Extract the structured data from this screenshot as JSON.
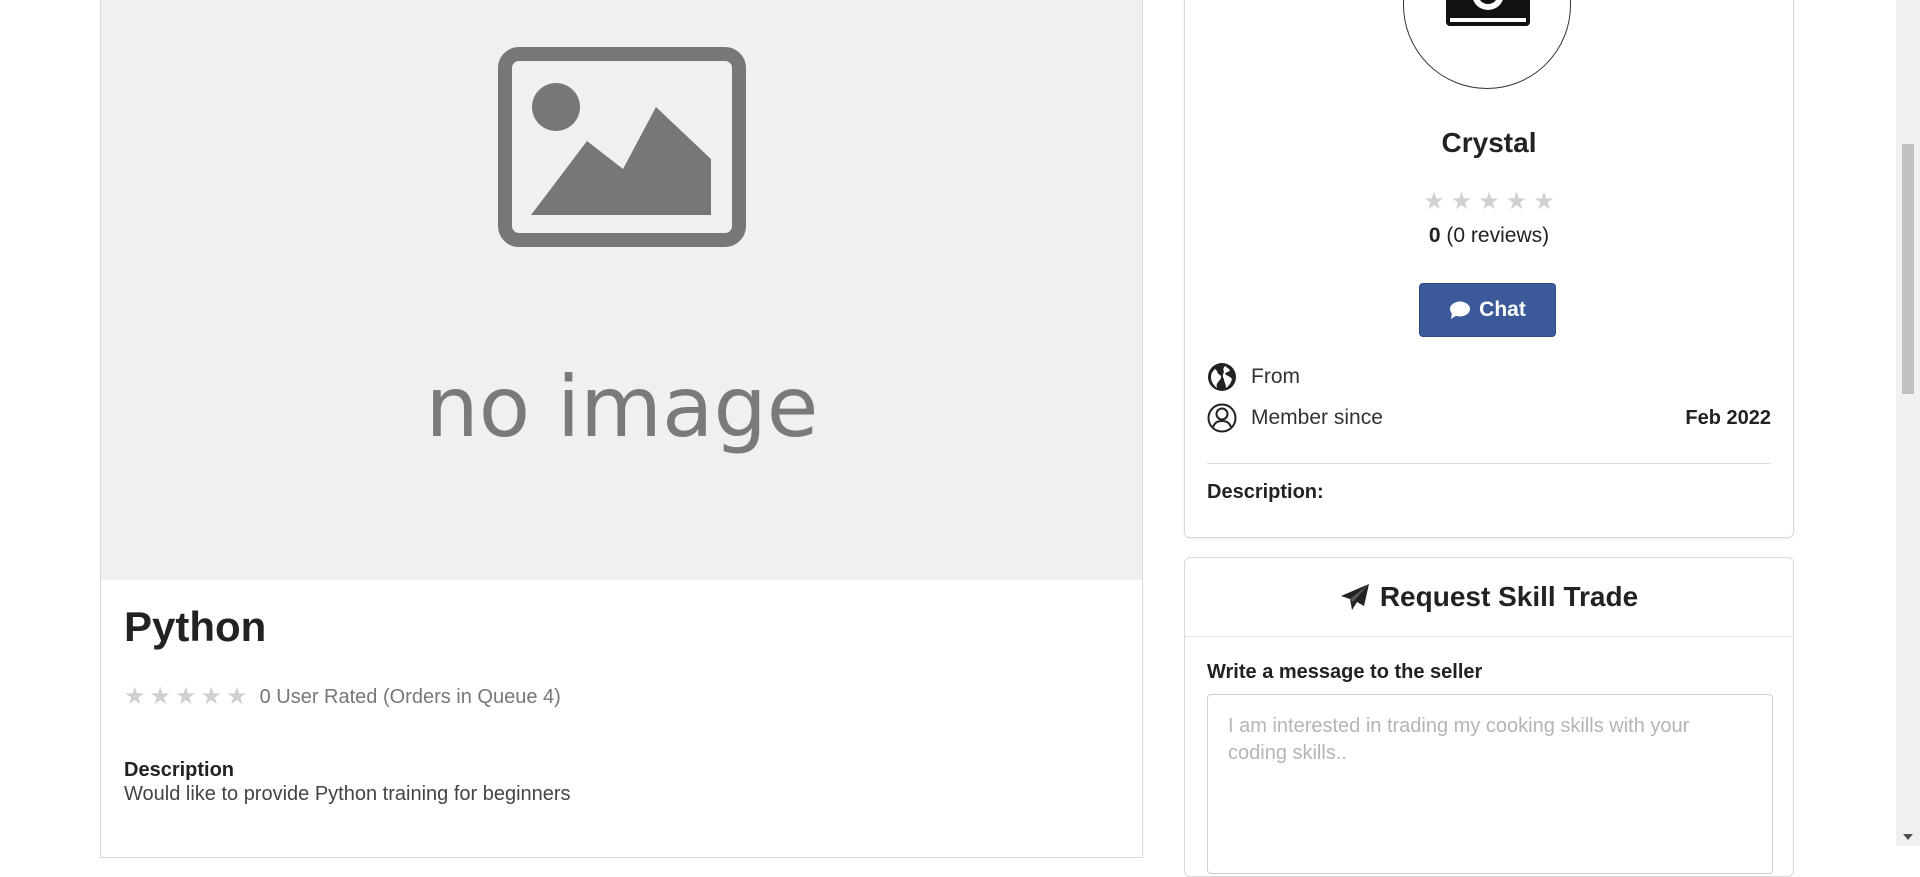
{
  "gig": {
    "image_placeholder_text": "no image",
    "title": "Python",
    "rating_text": "0 User Rated (Orders in Queue 4)",
    "stars_filled": 0,
    "stars_total": 5,
    "description_label": "Description",
    "description_text": "Would like to provide Python training for beginners"
  },
  "seller": {
    "name": "Crystal",
    "rating_value": "0",
    "reviews_text": "(0 reviews)",
    "stars_filled": 0,
    "chat_label": "Chat",
    "from_label": "From",
    "from_value": "",
    "member_since_label": "Member since",
    "member_since_value": "Feb 2022",
    "description_label": "Description:"
  },
  "request": {
    "title": "Request Skill Trade",
    "message_label": "Write a message to the seller",
    "message_placeholder": "I am interested in trading my cooking skills with your coding skills..",
    "message_value": ""
  },
  "colors": {
    "chat_button": "#3c5a9a",
    "star_empty": "#d0d0d0",
    "image_bg": "#f0f0f0",
    "placeholder_gray": "#7a7a7a"
  },
  "icons": {
    "chat": "comment-icon",
    "from": "globe-icon",
    "member": "user-circle-icon",
    "request": "paper-plane-icon",
    "avatar": "camera-icon"
  }
}
